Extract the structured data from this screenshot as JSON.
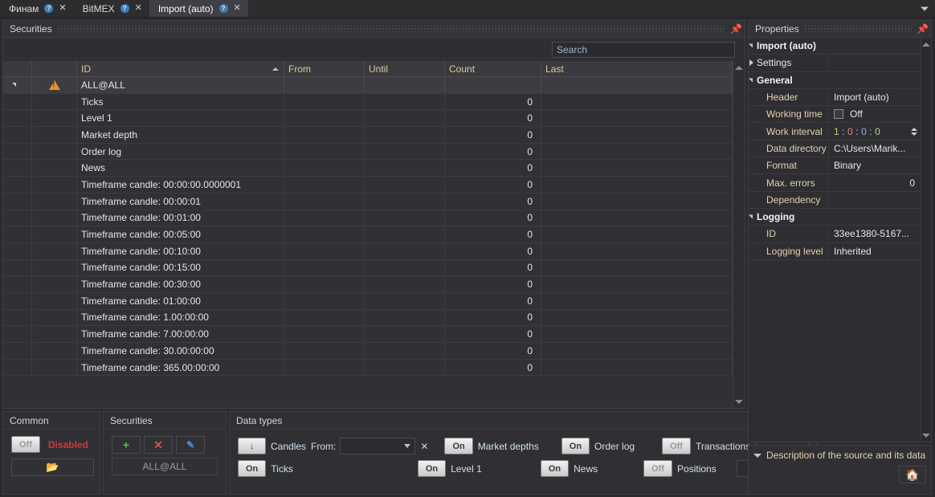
{
  "tabbar": {
    "tabs": [
      {
        "label": "Финам",
        "help": "?",
        "close": "✕"
      },
      {
        "label": "BitMEX",
        "help": "?",
        "close": "✕"
      },
      {
        "label": "Import (auto)",
        "help": "?",
        "close": "✕"
      }
    ],
    "overflow_icon": "chevron-down-icon"
  },
  "securities_panel": {
    "title": "Securities",
    "pin": "📌",
    "search": {
      "value": "",
      "placeholder": "Search"
    },
    "columns": [
      {
        "key": "id",
        "label": "ID",
        "sort": "asc"
      },
      {
        "key": "from",
        "label": "From"
      },
      {
        "key": "until",
        "label": "Until"
      },
      {
        "key": "count",
        "label": "Count"
      },
      {
        "key": "last",
        "label": "Last"
      }
    ],
    "rows": [
      {
        "id": "ALL@ALL",
        "from": "",
        "until": "",
        "count": "",
        "last": "",
        "parent": true,
        "warning": true
      },
      {
        "id": "Ticks",
        "from": "",
        "until": "",
        "count": "0",
        "last": ""
      },
      {
        "id": "Level 1",
        "from": "",
        "until": "",
        "count": "0",
        "last": ""
      },
      {
        "id": "Market depth",
        "from": "",
        "until": "",
        "count": "0",
        "last": ""
      },
      {
        "id": "Order log",
        "from": "",
        "until": "",
        "count": "0",
        "last": ""
      },
      {
        "id": "News",
        "from": "",
        "until": "",
        "count": "0",
        "last": ""
      },
      {
        "id": "Timeframe candle: 00:00:00.0000001",
        "from": "",
        "until": "",
        "count": "0",
        "last": ""
      },
      {
        "id": "Timeframe candle: 00:00:01",
        "from": "",
        "until": "",
        "count": "0",
        "last": ""
      },
      {
        "id": "Timeframe candle: 00:01:00",
        "from": "",
        "until": "",
        "count": "0",
        "last": ""
      },
      {
        "id": "Timeframe candle: 00:05:00",
        "from": "",
        "until": "",
        "count": "0",
        "last": ""
      },
      {
        "id": "Timeframe candle: 00:10:00",
        "from": "",
        "until": "",
        "count": "0",
        "last": ""
      },
      {
        "id": "Timeframe candle: 00:15:00",
        "from": "",
        "until": "",
        "count": "0",
        "last": ""
      },
      {
        "id": "Timeframe candle: 00:30:00",
        "from": "",
        "until": "",
        "count": "0",
        "last": ""
      },
      {
        "id": "Timeframe candle: 01:00:00",
        "from": "",
        "until": "",
        "count": "0",
        "last": ""
      },
      {
        "id": "Timeframe candle: 1.00:00:00",
        "from": "",
        "until": "",
        "count": "0",
        "last": ""
      },
      {
        "id": "Timeframe candle: 7.00:00:00",
        "from": "",
        "until": "",
        "count": "0",
        "last": ""
      },
      {
        "id": "Timeframe candle: 30.00:00:00",
        "from": "",
        "until": "",
        "count": "0",
        "last": ""
      },
      {
        "id": "Timeframe candle: 365.00:00:00",
        "from": "",
        "until": "",
        "count": "0",
        "last": ""
      }
    ]
  },
  "common_panel": {
    "title": "Common",
    "toggle_label": "Off",
    "status_label": "Disabled",
    "folder_icon": "open-folder-icon"
  },
  "securities_editor": {
    "title": "Securities",
    "add_icon": "plus-icon",
    "remove_icon": "cross-icon",
    "edit_icon": "pencil-icon",
    "selected": "ALL@ALL"
  },
  "data_types": {
    "title": "Data types",
    "candles": {
      "state": "↓",
      "label": "Candles"
    },
    "from_label": "From:",
    "from_value": "",
    "clear_icon": "✕",
    "items": [
      {
        "state": "On",
        "label": "Market depths"
      },
      {
        "state": "On",
        "label": "Order log"
      },
      {
        "state": "Off",
        "label": "Transactions"
      },
      {
        "state": "On",
        "label": "Ticks"
      },
      {
        "state": "On",
        "label": "Level 1"
      },
      {
        "state": "On",
        "label": "News"
      },
      {
        "state": "Off",
        "label": "Positions"
      }
    ]
  },
  "properties": {
    "title": "Properties",
    "pin": "📌",
    "rows": [
      {
        "type": "category",
        "name": "Import (auto)",
        "expanded": true,
        "value": ""
      },
      {
        "type": "sub-category",
        "name": "Settings",
        "expanded": false,
        "value": ""
      },
      {
        "type": "category",
        "name": "General",
        "expanded": true,
        "value": ""
      },
      {
        "type": "field",
        "name": "Header",
        "value": "Import (auto)"
      },
      {
        "type": "checkbox",
        "name": "Working time",
        "value": "Off",
        "checked": false
      },
      {
        "type": "interval",
        "name": "Work interval",
        "value": "1 : 0 : 0 : 0",
        "parts": [
          "1",
          "0",
          "0",
          "0"
        ]
      },
      {
        "type": "field",
        "name": "Data directory",
        "value": "C:\\Users\\Marik..."
      },
      {
        "type": "field",
        "name": "Format",
        "value": "Binary"
      },
      {
        "type": "number",
        "name": "Max. errors",
        "value": "0"
      },
      {
        "type": "field",
        "name": "Dependency",
        "value": ""
      },
      {
        "type": "category",
        "name": "Logging",
        "expanded": true,
        "value": ""
      },
      {
        "type": "field",
        "name": "ID",
        "value": "33ee1380-5167..."
      },
      {
        "type": "field",
        "name": "Logging level",
        "value": "Inherited"
      }
    ]
  },
  "description_panel": {
    "text": "Description of the source and its data",
    "home_icon": "home-icon"
  }
}
